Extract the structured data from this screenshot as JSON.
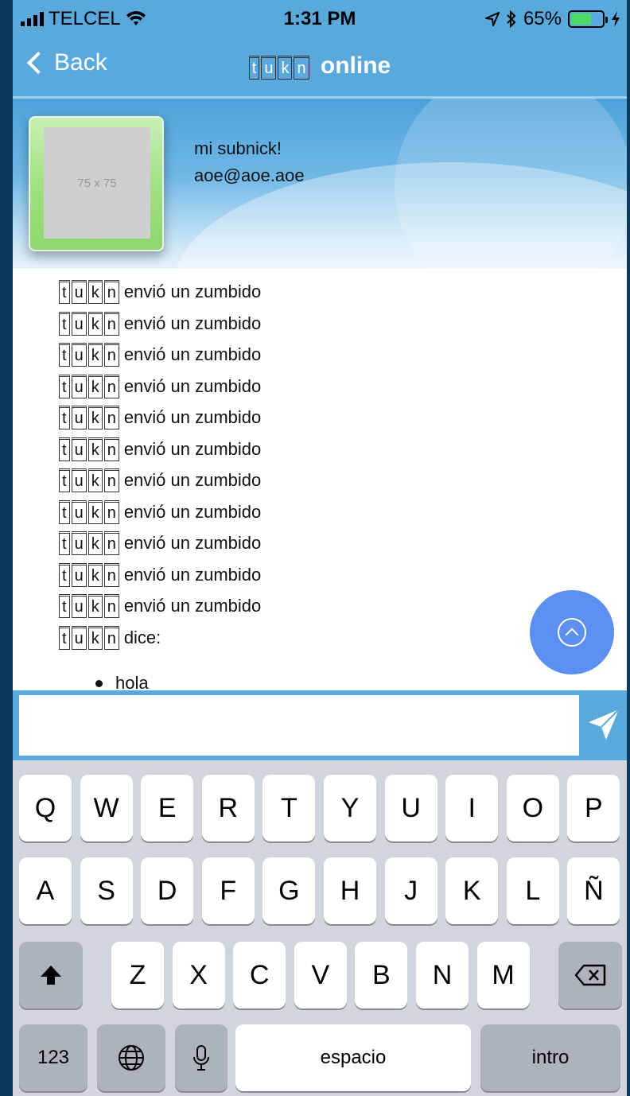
{
  "status_bar": {
    "carrier": "TELCEL",
    "time": "1:31 PM",
    "battery_percent": "65%",
    "battery_level": 0.65,
    "icons": [
      "signal-icon",
      "wifi-icon",
      "location-icon",
      "bluetooth-icon",
      "battery-icon",
      "charging-icon"
    ]
  },
  "nav": {
    "back_label": "Back",
    "title_brand": [
      "t",
      "u",
      "k",
      "n"
    ],
    "title_suffix": "online"
  },
  "profile": {
    "avatar_placeholder": "75 x 75",
    "subnick": "mi subnick!",
    "email": "aoe@aoe.aoe"
  },
  "messages": [
    {
      "text": "envió un zumbido"
    },
    {
      "text": "envió un zumbido"
    },
    {
      "text": "envió un zumbido"
    },
    {
      "text": "envió un zumbido"
    },
    {
      "text": "envió un zumbido"
    },
    {
      "text": "envió un zumbido"
    },
    {
      "text": "envió un zumbido"
    },
    {
      "text": "envió un zumbido"
    },
    {
      "text": "envió un zumbido"
    },
    {
      "text": "envió un zumbido"
    },
    {
      "text": "envió un zumbido"
    },
    {
      "text": "dice:"
    }
  ],
  "message_items": [
    "hola"
  ],
  "composer": {
    "value": "",
    "placeholder": ""
  },
  "keyboard": {
    "row1": [
      "Q",
      "W",
      "E",
      "R",
      "T",
      "Y",
      "U",
      "I",
      "O",
      "P"
    ],
    "row2": [
      "A",
      "S",
      "D",
      "F",
      "G",
      "H",
      "J",
      "K",
      "L",
      "Ñ"
    ],
    "row3": [
      "Z",
      "X",
      "C",
      "V",
      "B",
      "N",
      "M"
    ],
    "numbers_label": "123",
    "space_label": "espacio",
    "return_label": "intro"
  },
  "colors": {
    "header_blue": "#5aa9dc",
    "fab_blue": "#5b8ff0",
    "keyboard_bg": "#d2d5db"
  }
}
